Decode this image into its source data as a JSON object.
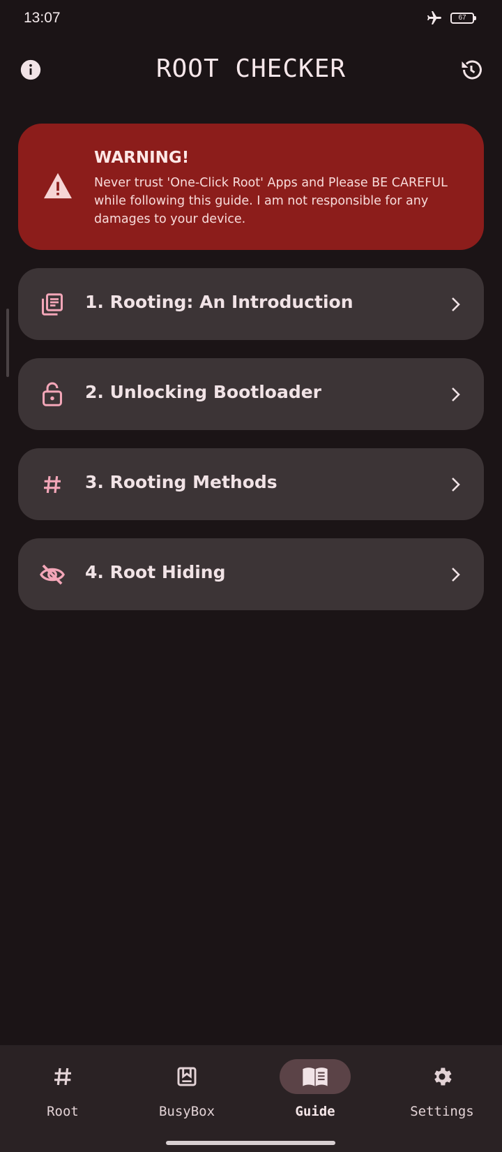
{
  "status_bar": {
    "time": "13:07",
    "battery": "67"
  },
  "app_bar": {
    "title": "ROOT CHECKER"
  },
  "warning": {
    "title": "WARNING!",
    "text": "Never trust 'One-Click Root' Apps and Please BE CAREFUL while following this guide. I am not responsible for any damages to your device."
  },
  "guide_items": [
    {
      "label": "1. Rooting: An Introduction",
      "icon": "article-icon"
    },
    {
      "label": "2. Unlocking Bootloader",
      "icon": "lock-open-icon"
    },
    {
      "label": "3. Rooting Methods",
      "icon": "hash-icon"
    },
    {
      "label": "4. Root Hiding",
      "icon": "eye-off-icon"
    }
  ],
  "bottom_nav": [
    {
      "label": "Root",
      "icon": "hash-icon"
    },
    {
      "label": "BusyBox",
      "icon": "busybox-icon"
    },
    {
      "label": "Guide",
      "icon": "book-icon",
      "active": true
    },
    {
      "label": "Settings",
      "icon": "gear-icon"
    }
  ],
  "colors": {
    "background": "#1b1416",
    "warning_card": "#8c1d1b",
    "list_item": "#3c3436",
    "accent_icon": "#f3a6b8",
    "nav_bar": "#2a2224",
    "nav_active_pill": "#5b4347"
  }
}
